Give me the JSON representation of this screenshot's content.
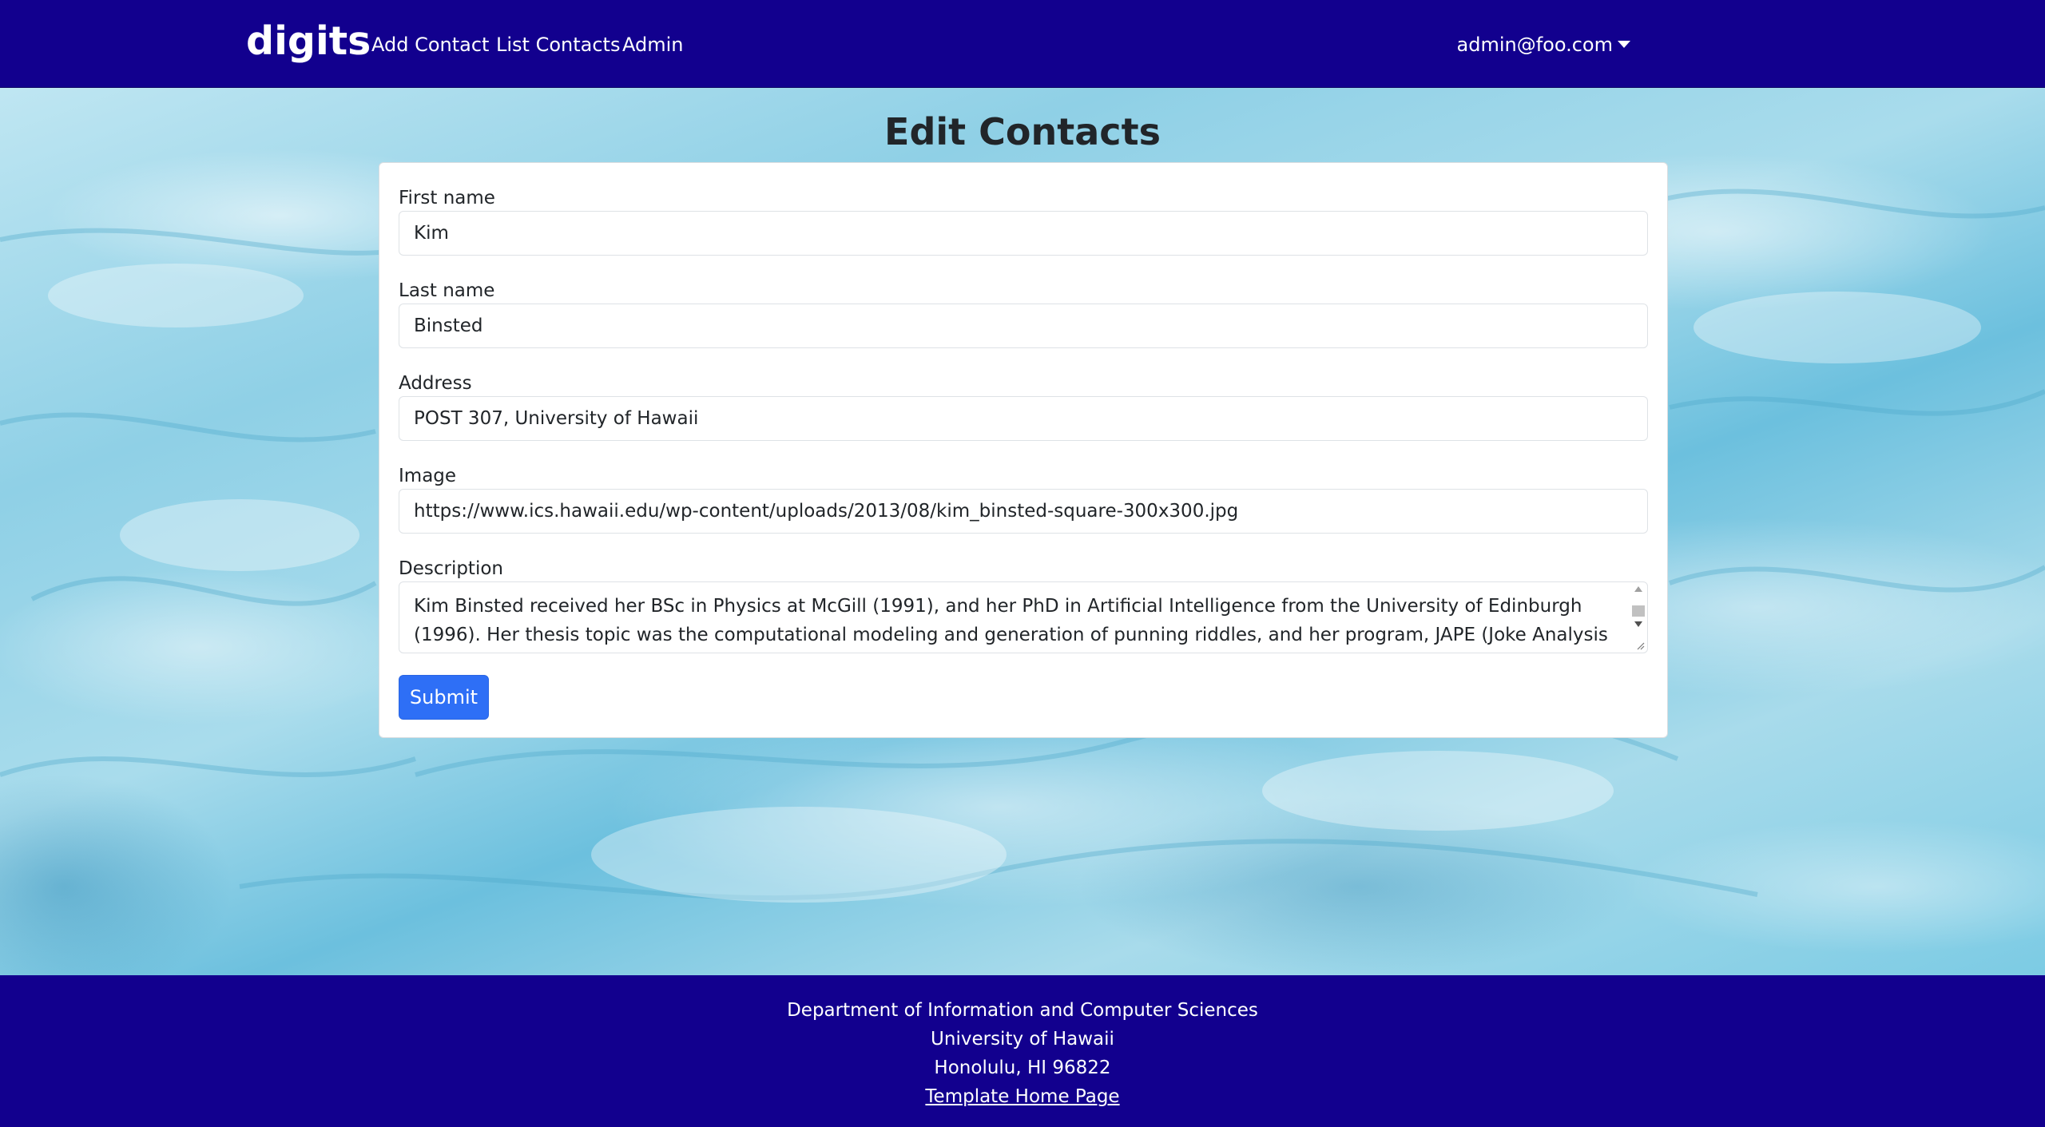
{
  "navbar": {
    "brand": "digits",
    "links": [
      "Add Contact",
      "List Contacts",
      "Admin"
    ],
    "user": "admin@foo.com"
  },
  "page": {
    "title": "Edit Contacts"
  },
  "form": {
    "first_name": {
      "label": "First name",
      "value": "Kim"
    },
    "last_name": {
      "label": "Last name",
      "value": "Binsted"
    },
    "address": {
      "label": "Address",
      "value": "POST 307, University of Hawaii"
    },
    "image": {
      "label": "Image",
      "value": "https://www.ics.hawaii.edu/wp-content/uploads/2013/08/kim_binsted-square-300x300.jpg"
    },
    "description": {
      "label": "Description",
      "value": "Kim Binsted received her BSc in Physics at McGill (1991), and her PhD in Artificial Intelligence from the University of Edinburgh (1996). Her thesis topic was the computational modeling and generation of punning riddles, and her program, JAPE (Joke Analysis and Production"
    },
    "submit_label": "Submit"
  },
  "footer": {
    "lines": [
      "Department of Information and Computer Sciences",
      "University of Hawaii",
      "Honolulu, HI 96822"
    ],
    "link": "Template Home Page"
  },
  "colors": {
    "navbar_bg": "#12008e",
    "primary_button": "#2e6ff6"
  }
}
